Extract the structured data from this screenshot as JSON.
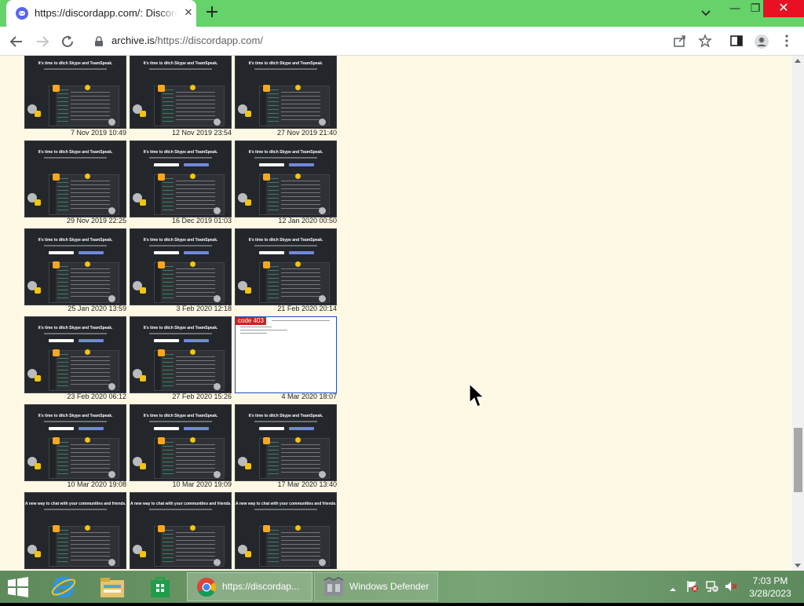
{
  "browser": {
    "tab_title": "https://discordapp.com/: Discord",
    "tab_close": "✕",
    "new_tab": "+",
    "url_host": "archive.is",
    "url_path": "/https://discordapp.com/",
    "window": {
      "minimize": "—",
      "restore": "❐",
      "close": "✕"
    }
  },
  "thumbs": {
    "headline_old": "It's time to ditch Skype and TeamSpeak.",
    "headline_new": "A new way to chat with your communities and friends.",
    "error_code": "code 403"
  },
  "snapshots": [
    {
      "date": "7 Nov 2019 10:49"
    },
    {
      "date": "12 Nov 2019 23:54"
    },
    {
      "date": "27 Nov 2019 21:40"
    },
    {
      "date": "29 Nov 2019 22:25"
    },
    {
      "date": "16 Dec 2019 01:03"
    },
    {
      "date": "12 Jan 2020 00:50"
    },
    {
      "date": "25 Jan 2020 13:59"
    },
    {
      "date": "3 Feb 2020 12:18"
    },
    {
      "date": "21 Feb 2020 20:14"
    },
    {
      "date": "23 Feb 2020 06:12"
    },
    {
      "date": "27 Feb 2020 15:26"
    },
    {
      "date": "4 Mar 2020 18:07"
    },
    {
      "date": "10 Mar 2020 19:08"
    },
    {
      "date": "10 Mar 2020 19:09"
    },
    {
      "date": "17 Mar 2020 13:40"
    }
  ],
  "taskbar": {
    "chrome_label": "https://discordap...",
    "defender_label": "Windows Defender",
    "time": "7:03 PM",
    "date": "3/28/2023"
  },
  "colors": {
    "tab_strip": "#65d26a",
    "page_bg": "#fdf9e4",
    "discord_blurple": "#7289da",
    "error_red": "#cc2222",
    "close_red": "#e81123"
  }
}
